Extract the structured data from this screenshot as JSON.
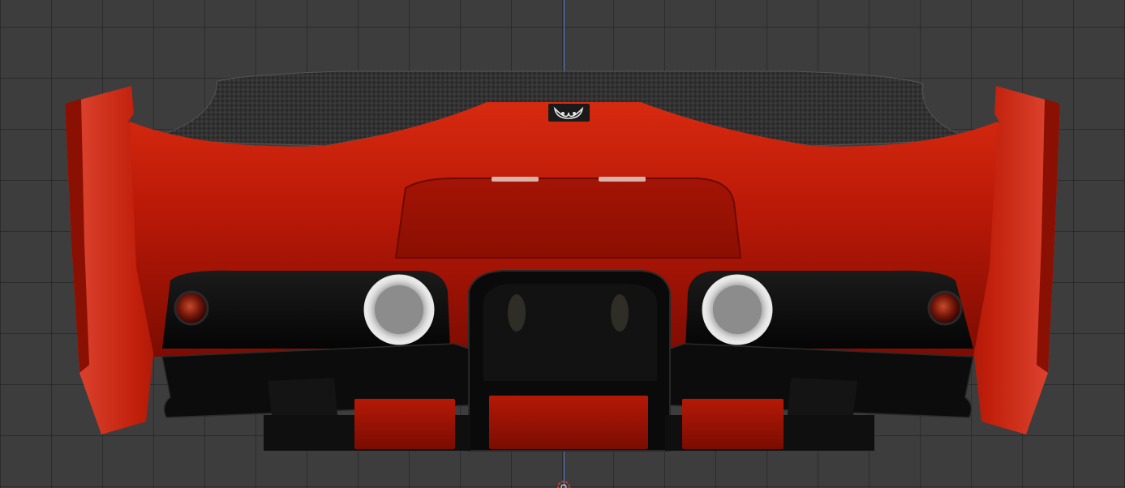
{
  "viewport": {
    "background": "#3d3d3d",
    "grid_color": "#2f2f2f",
    "axis_color": "#5f7fd6"
  },
  "model": {
    "subject": "car rear view",
    "body_color": "#c21a08",
    "body_dark_color": "#6e0a02",
    "carbon_color": "#2b2b2b",
    "diffuser_color": "#0b0b0b",
    "exhaust_color": "#bdbdbd",
    "badge_icon": "owl-badge-icon"
  },
  "origin": {
    "icon": "origin-icon",
    "colors": [
      "#d33a2a",
      "#ffffff"
    ]
  }
}
